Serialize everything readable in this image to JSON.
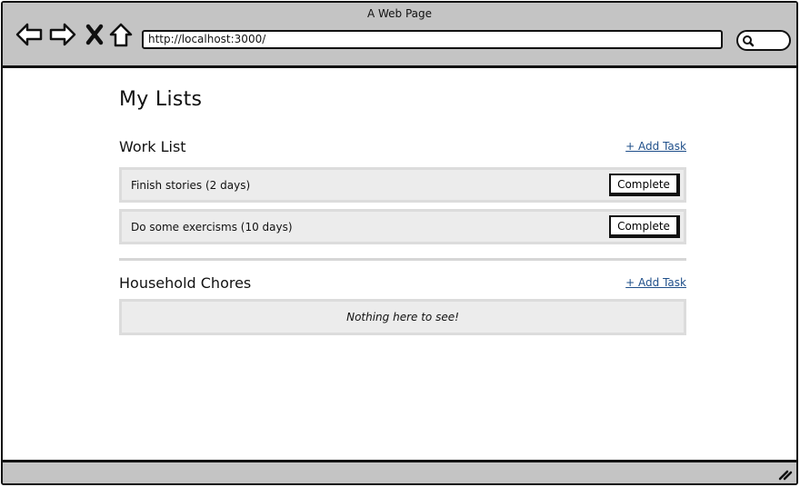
{
  "window": {
    "title": "A Web Page",
    "address": "http://localhost:3000/"
  },
  "nav": {
    "back_icon": "back-arrow-icon",
    "forward_icon": "forward-arrow-icon",
    "stop_icon": "close-icon",
    "home_icon": "home-icon",
    "search_icon": "search-icon"
  },
  "page": {
    "title": "My Lists"
  },
  "lists": [
    {
      "name": "Work List",
      "add_label": "+ Add Task",
      "tasks": [
        {
          "label": "Finish stories (2 days)",
          "action": "Complete"
        },
        {
          "label": "Do some exercisms (10 days)",
          "action": "Complete"
        }
      ]
    },
    {
      "name": "Household Chores",
      "add_label": "+ Add Task",
      "empty_text": "Nothing here to see!"
    }
  ],
  "colors": {
    "chrome": "#c4c4c4",
    "row_bg": "#ececec",
    "link": "#1f4f8a"
  }
}
